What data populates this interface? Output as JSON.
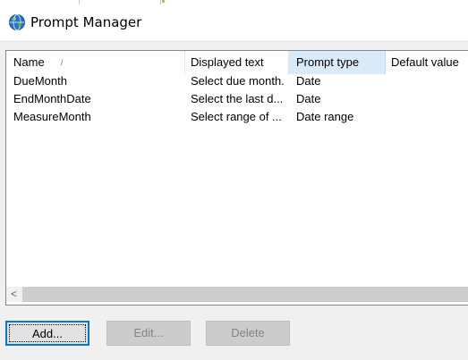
{
  "window": {
    "title": "Prompt Manager",
    "icon": "globe-icon"
  },
  "table": {
    "columns": [
      {
        "label": "Name",
        "sort_indicator": "/"
      },
      {
        "label": "Displayed text"
      },
      {
        "label": "Prompt type"
      },
      {
        "label": "Default value"
      }
    ],
    "sorted_column": "Prompt type",
    "rows": [
      {
        "name": "DueMonth",
        "displayed_text": "Select due month.",
        "prompt_type": "Date"
      },
      {
        "name": "EndMonthDate",
        "displayed_text": "Select the last d...",
        "prompt_type": "Date"
      },
      {
        "name": "MeasureMonth",
        "displayed_text": "Select range of ...",
        "prompt_type": "Date range"
      }
    ]
  },
  "scrollbar": {
    "left_arrow": "<"
  },
  "buttons": {
    "add": "Add...",
    "edit": "Edit...",
    "delete": "Delete"
  },
  "colors": {
    "sorted_header": "#d9ebf9",
    "focus_border": "#0078d7"
  }
}
